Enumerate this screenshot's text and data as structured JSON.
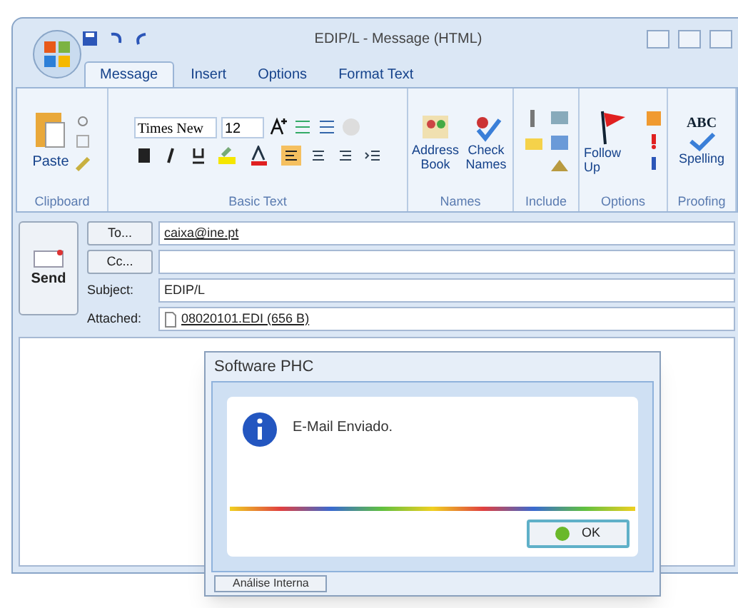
{
  "window": {
    "title": "EDIP/L - Message (HTML)"
  },
  "tabs": [
    {
      "label": "Message",
      "selected": true
    },
    {
      "label": "Insert",
      "selected": false
    },
    {
      "label": "Options",
      "selected": false
    },
    {
      "label": "Format Text",
      "selected": false
    }
  ],
  "ribbon": {
    "clipboard": {
      "paste": "Paste",
      "group": "Clipboard"
    },
    "basic_text": {
      "font": "Times New",
      "size": "12",
      "group": "Basic Text"
    },
    "names": {
      "buttons": [
        "Address Book",
        "Check Names"
      ],
      "group": "Names"
    },
    "include": {
      "group": "Include"
    },
    "options": {
      "follow_up": "Follow Up",
      "group": "Options"
    },
    "proofing": {
      "abc": "ABC",
      "spelling": "Spelling",
      "group": "Proofing"
    }
  },
  "send": "Send",
  "fields": [
    {
      "kind": "button",
      "label": "To...",
      "value": "caixa@ine.pt"
    },
    {
      "kind": "button",
      "label": "Cc..."
    },
    {
      "kind": "label",
      "label": "Subject:",
      "value": "EDIP/L"
    },
    {
      "kind": "attach",
      "label": "Attached:",
      "value": "08020101.EDI (656 B)"
    }
  ],
  "dialog": {
    "title": "Software PHC",
    "message": "E-Mail Enviado.",
    "ok": "OK",
    "tab": "Análise Interna"
  }
}
